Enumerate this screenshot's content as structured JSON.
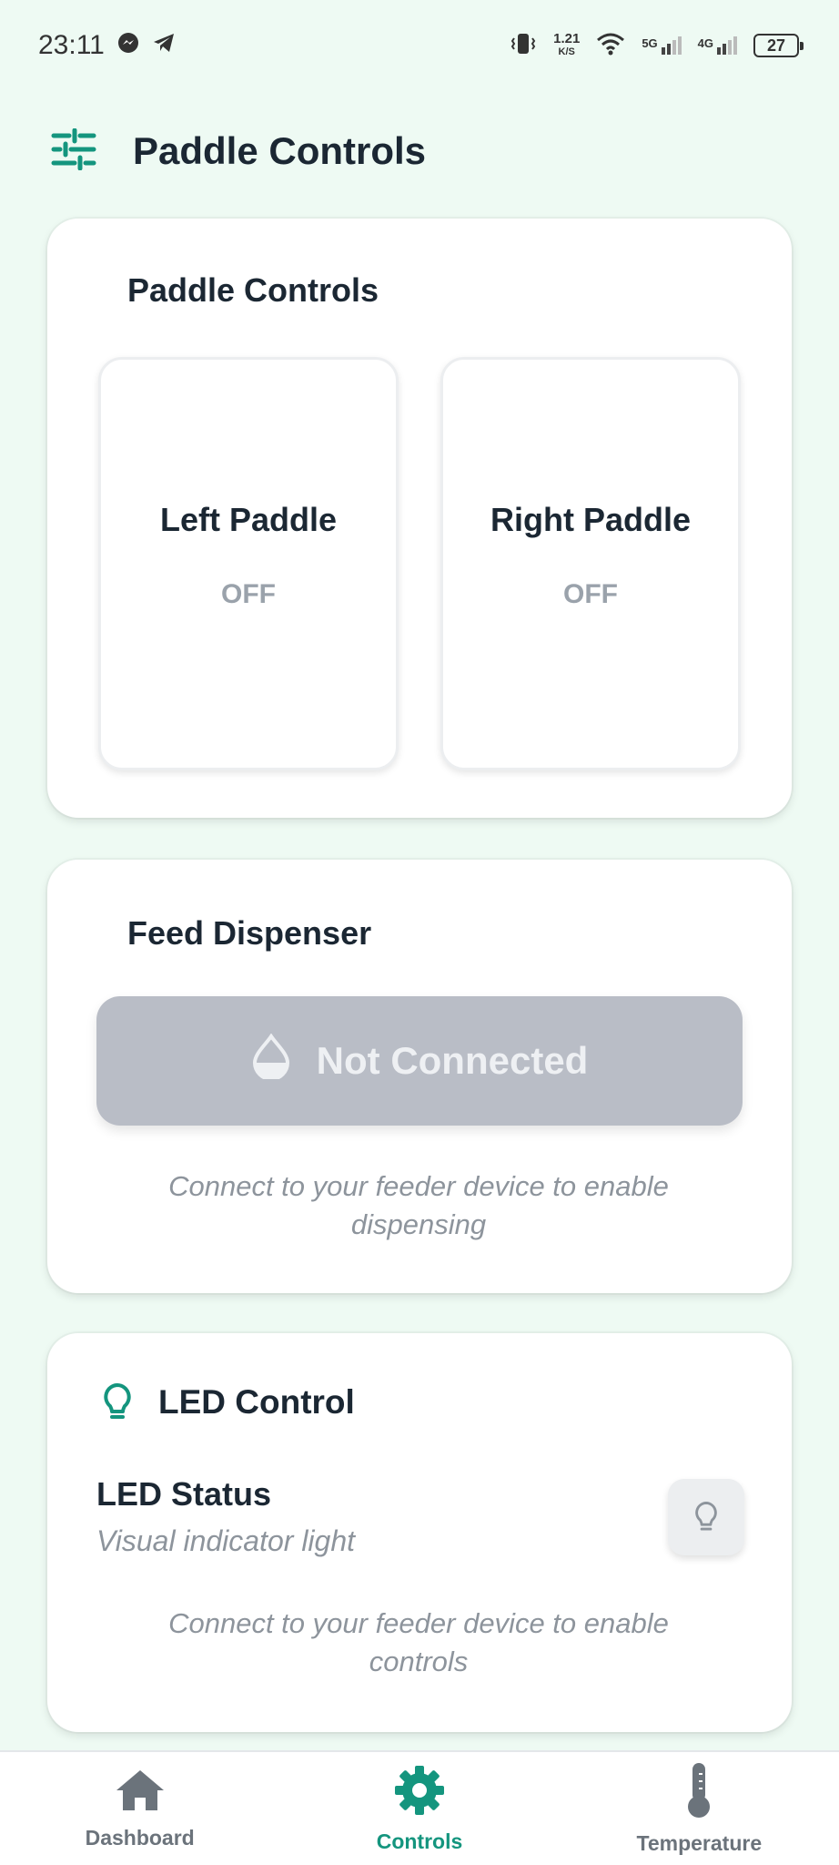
{
  "status_bar": {
    "time": "23:11",
    "net_speed_value": "1.21",
    "net_speed_unit": "K/S",
    "sig1_label": "5G",
    "sig2_label": "4G",
    "battery": "27"
  },
  "header": {
    "title": "Paddle Controls",
    "icon": "sliders-icon"
  },
  "paddle_card": {
    "title": "Paddle Controls",
    "left": {
      "name": "Left Paddle",
      "state": "OFF"
    },
    "right": {
      "name": "Right Paddle",
      "state": "OFF"
    }
  },
  "feed_card": {
    "title": "Feed Dispenser",
    "button_label": "Not Connected",
    "hint": "Connect to your feeder device to enable dispensing"
  },
  "led_card": {
    "title": "LED Control",
    "status_label": "LED Status",
    "status_sub": "Visual indicator light",
    "hint": "Connect to your feeder device to enable controls"
  },
  "nav": {
    "items": [
      {
        "label": "Dashboard",
        "icon": "home-icon"
      },
      {
        "label": "Controls",
        "icon": "gear-icon"
      },
      {
        "label": "Temperature",
        "icon": "thermometer-icon"
      }
    ]
  },
  "colors": {
    "accent": "#14957e",
    "background": "#eefaf3",
    "disabled_button": "#b9bdc6",
    "muted_text": "#8d949c"
  }
}
